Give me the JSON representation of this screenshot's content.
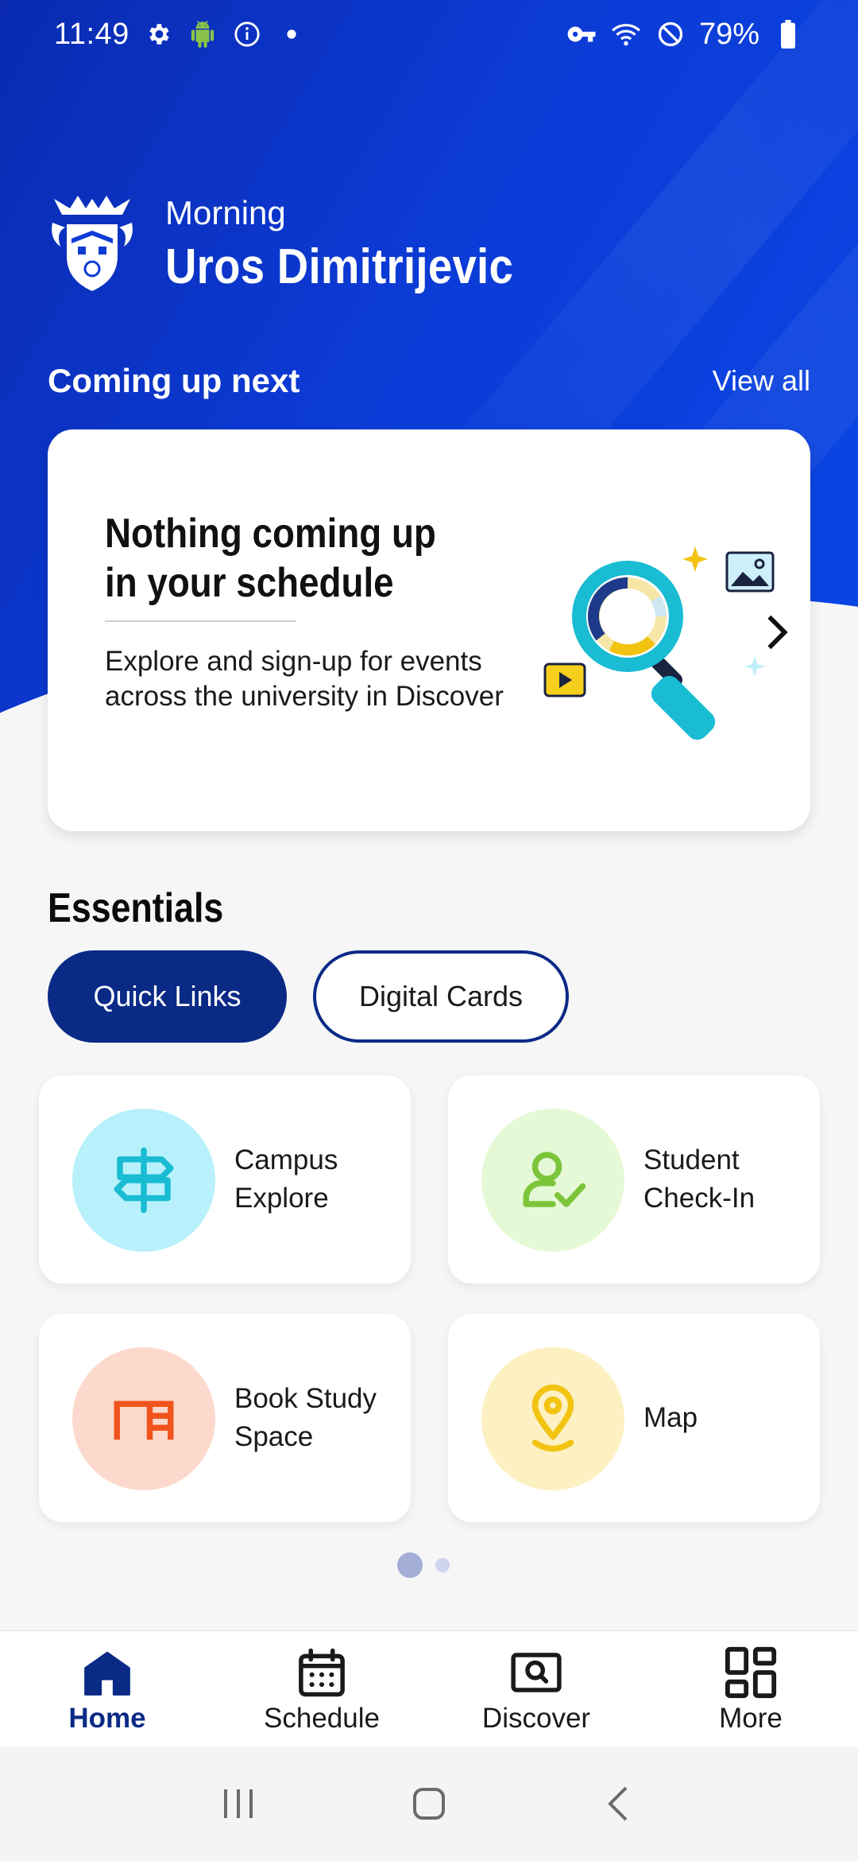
{
  "status_bar": {
    "time": "11:49",
    "battery": "79%",
    "left_icons": [
      "gear-icon",
      "android-icon",
      "info-icon",
      "dot-icon"
    ],
    "right_icons": [
      "vpn-key-icon",
      "wifi-icon",
      "do-not-disturb-icon",
      "battery-icon"
    ]
  },
  "header": {
    "greeting": "Morning",
    "user_name": "Uros Dimitrijevic"
  },
  "coming_up": {
    "title": "Coming up next",
    "view_all": "View all",
    "card": {
      "title": "Nothing coming up in your schedule",
      "body": "Explore and sign-up for events across the university in Discover"
    }
  },
  "essentials": {
    "title": "Essentials",
    "chips": [
      {
        "label": "Quick Links",
        "active": true
      },
      {
        "label": "Digital Cards",
        "active": false
      }
    ],
    "tiles": [
      {
        "label": "Campus Explore",
        "icon": "signpost-icon",
        "bg": "#b8f1fb",
        "fg": "#19bcd3"
      },
      {
        "label": "Student Check-In",
        "icon": "user-check-icon",
        "bg": "#e6f9d6",
        "fg": "#7cc43a"
      },
      {
        "label": "Book Study Space",
        "icon": "desk-icon",
        "bg": "#fcd9cc",
        "fg": "#f0541c"
      },
      {
        "label": "Map",
        "icon": "map-pin-icon",
        "bg": "#fdf0c2",
        "fg": "#f2c311"
      }
    ],
    "pager": {
      "current": 1,
      "total": 2
    }
  },
  "bottom_nav": {
    "items": [
      {
        "label": "Home",
        "icon": "home-icon",
        "active": true
      },
      {
        "label": "Schedule",
        "icon": "calendar-icon",
        "active": false
      },
      {
        "label": "Discover",
        "icon": "discover-icon",
        "active": false
      },
      {
        "label": "More",
        "icon": "grid-icon",
        "active": false
      }
    ]
  },
  "colors": {
    "primary": "#0a2a86",
    "hero": "#0c3bd6"
  }
}
